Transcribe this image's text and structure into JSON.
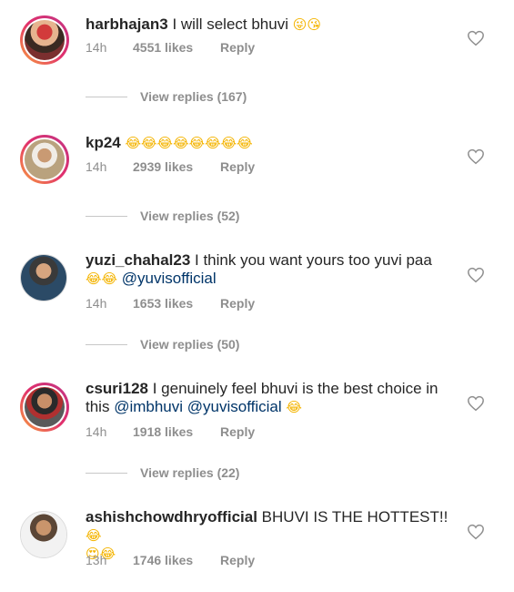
{
  "comments": [
    {
      "username": "harbhajan3",
      "text": "I will select bhuvi",
      "emoji": "😜😘",
      "time": "14h",
      "likes": "4551 likes",
      "reply": "Reply",
      "view_replies": "View replies (167)"
    },
    {
      "username": "kp24",
      "text": "",
      "emoji": "😂😂😂😂😂😂😂😂",
      "time": "14h",
      "likes": "2939 likes",
      "reply": "Reply",
      "view_replies": "View replies (52)"
    },
    {
      "username": "yuzi_chahal23",
      "text": "I think you want yours too yuvi paa",
      "emoji": "😂😂",
      "mention": "@yuvisofficial",
      "time": "14h",
      "likes": "1653 likes",
      "reply": "Reply",
      "view_replies": "View replies (50)"
    },
    {
      "username": "csuri128",
      "text": "I genuinely feel bhuvi is the best choice in this",
      "mention1": "@imbhuvi",
      "mention2": "@yuvisofficial",
      "emoji": "😂",
      "time": "14h",
      "likes": "1918 likes",
      "reply": "Reply",
      "view_replies": "View replies (22)"
    },
    {
      "username": "ashishchowdhryofficial",
      "text": "BHUVI IS THE HOTTEST!!",
      "emoji": "😂",
      "emoji2": "😍😂",
      "time": "13h",
      "likes": "1746 likes",
      "reply": "Reply"
    }
  ],
  "icons": {
    "like": "heart-outline-icon"
  }
}
